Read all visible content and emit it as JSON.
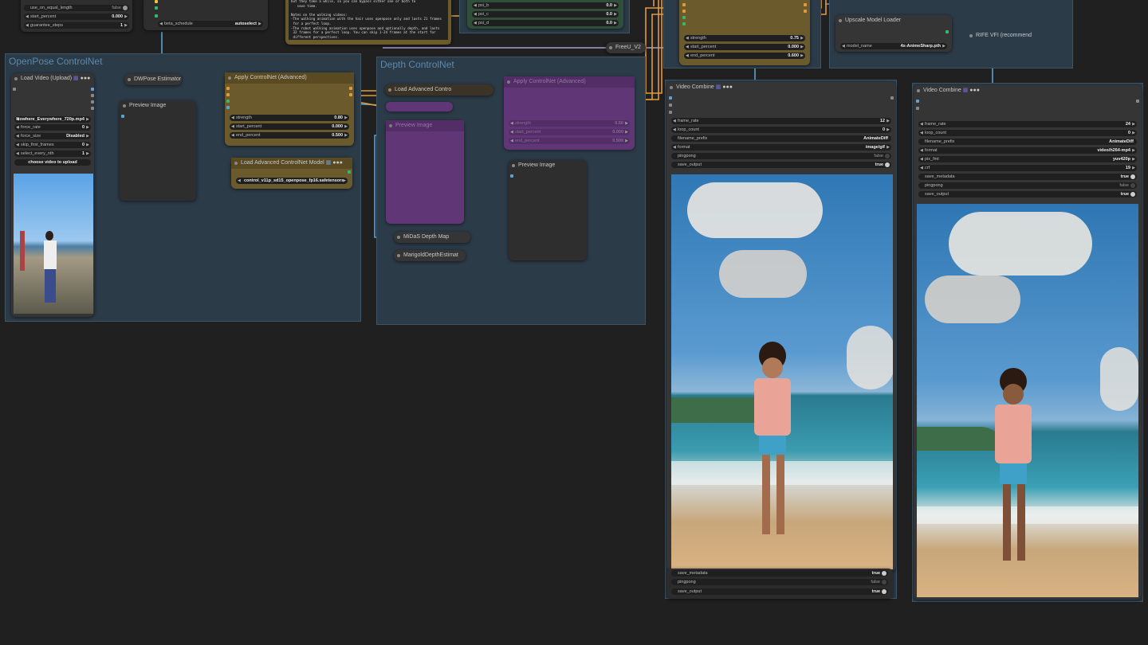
{
  "colors": {
    "canvas": "#202020",
    "group": "#2c3b48",
    "node": "#353535",
    "olive": "#6b5a2c",
    "purple": "#6b3680",
    "wire_blue": "#5aa3d6",
    "wire_orange": "#e29a3a"
  },
  "top_left_node": {
    "rows": [
      {
        "label": "",
        "value": "pyramid"
      },
      {
        "label": "use_on_equal_length",
        "value": "false"
      },
      {
        "label": "start_percent",
        "value": "0.000"
      },
      {
        "label": "guarantee_steps",
        "value": "1"
      }
    ]
  },
  "beta_node": {
    "beta_schedule_label": "beta_schedule",
    "beta_schedule_value": "autoselect"
  },
  "note_text": "but they take a while, so you can bypass either one or both to\n   save time.\n\nNotes on the walking videos:\n-The walking animation with the hair uses openpose only and lasts 21 frames\n for a perfect loop.\n-The robot walking animation uses openpose and optionally depth, and lasts\n 32 frames for a perfect loop. You can skip 1-24 frames at the start for\n different perspectives.",
  "psi_node": {
    "rows": [
      {
        "label": "psi_b",
        "value": "0.0"
      },
      {
        "label": "psi_c",
        "value": "0.0"
      },
      {
        "label": "psi_d",
        "value": "0.0"
      }
    ]
  },
  "freeu": {
    "title": "FreeU_V2"
  },
  "top_olive_node": {
    "rows": [
      {
        "label": "strength",
        "value": "0.75"
      },
      {
        "label": "start_percent",
        "value": "0.000"
      },
      {
        "label": "end_percent",
        "value": "0.600"
      }
    ]
  },
  "upscale_loader": {
    "title": "Upscale Model Loader",
    "model_label": "model_name",
    "model_value": "4x-AnimeSharp.pth"
  },
  "rife": {
    "title": "RIFE VFI (recommend"
  },
  "openpose_group": {
    "title": "OpenPose ControlNet"
  },
  "depth_group": {
    "title": "Depth ControlNet"
  },
  "load_video": {
    "title": "Load Video (Upload)",
    "rows": [
      {
        "label": "",
        "value": "Nowhere_Everywhere_720p.mp4"
      },
      {
        "label": "force_rate",
        "value": "0"
      },
      {
        "label": "force_size",
        "value": "Disabled"
      },
      {
        "label": "skip_first_frames",
        "value": "0"
      },
      {
        "label": "select_every_nth",
        "value": "1"
      }
    ],
    "upload_label": "choose video to upload"
  },
  "dwpose": {
    "title": "DWPose Estimator"
  },
  "preview1": {
    "title": "Preview Image"
  },
  "apply_cn": {
    "title": "Apply ControlNet (Advanced)",
    "rows": [
      {
        "label": "strength",
        "value": "0.80"
      },
      {
        "label": "start_percent",
        "value": "0.000"
      },
      {
        "label": "end_percent",
        "value": "0.500"
      }
    ]
  },
  "load_adv_cn_model": {
    "title": "Load Advanced ControlNet Model",
    "model_value": "control_v11p_sd15_openpose_fp16.safetensors"
  },
  "load_adv_contro": {
    "title": "Load Advanced Contro"
  },
  "apply_cn2": {
    "title": "Apply ControlNet (Advanced)",
    "rows": [
      {
        "label": "strength",
        "value": "0.50"
      },
      {
        "label": "start_percent",
        "value": "0.000"
      },
      {
        "label": "end_percent",
        "value": "0.500"
      }
    ]
  },
  "preview_purple": {
    "title": "Preview Image"
  },
  "preview_depth": {
    "title": "Preview Image"
  },
  "midas": {
    "title": "MiDaS Depth Map"
  },
  "marigold": {
    "title": "MarigoldDepthEstimat"
  },
  "video_combine_1": {
    "title": "Video Combine",
    "rows": [
      {
        "label": "frame_rate",
        "value": "12",
        "type": "num"
      },
      {
        "label": "loop_count",
        "value": "0",
        "type": "num"
      },
      {
        "label": "filename_prefix",
        "value": "AnimateDiff",
        "type": "text"
      },
      {
        "label": "format",
        "value": "image/gif",
        "type": "num"
      },
      {
        "label": "pingpong",
        "value": "false",
        "type": "tog"
      },
      {
        "label": "save_output",
        "value": "true",
        "type": "tog"
      }
    ],
    "bottom_rows": [
      {
        "label": "save_metadata",
        "value": "true"
      },
      {
        "label": "pingpong",
        "value": "false"
      },
      {
        "label": "save_output",
        "value": "true"
      }
    ]
  },
  "video_combine_2": {
    "title": "Video Combine",
    "rows": [
      {
        "label": "frame_rate",
        "value": "24",
        "type": "num"
      },
      {
        "label": "loop_count",
        "value": "0",
        "type": "num"
      },
      {
        "label": "filename_prefix",
        "value": "AnimateDiff",
        "type": "text"
      },
      {
        "label": "format",
        "value": "video/h264-mp4",
        "type": "num"
      },
      {
        "label": "pix_fmt",
        "value": "yuv420p",
        "type": "num"
      },
      {
        "label": "crf",
        "value": "19",
        "type": "num"
      },
      {
        "label": "save_metadata",
        "value": "true",
        "type": "tog"
      },
      {
        "label": "pingpong",
        "value": "false",
        "type": "tog"
      },
      {
        "label": "save_output",
        "value": "true",
        "type": "tog"
      }
    ]
  }
}
